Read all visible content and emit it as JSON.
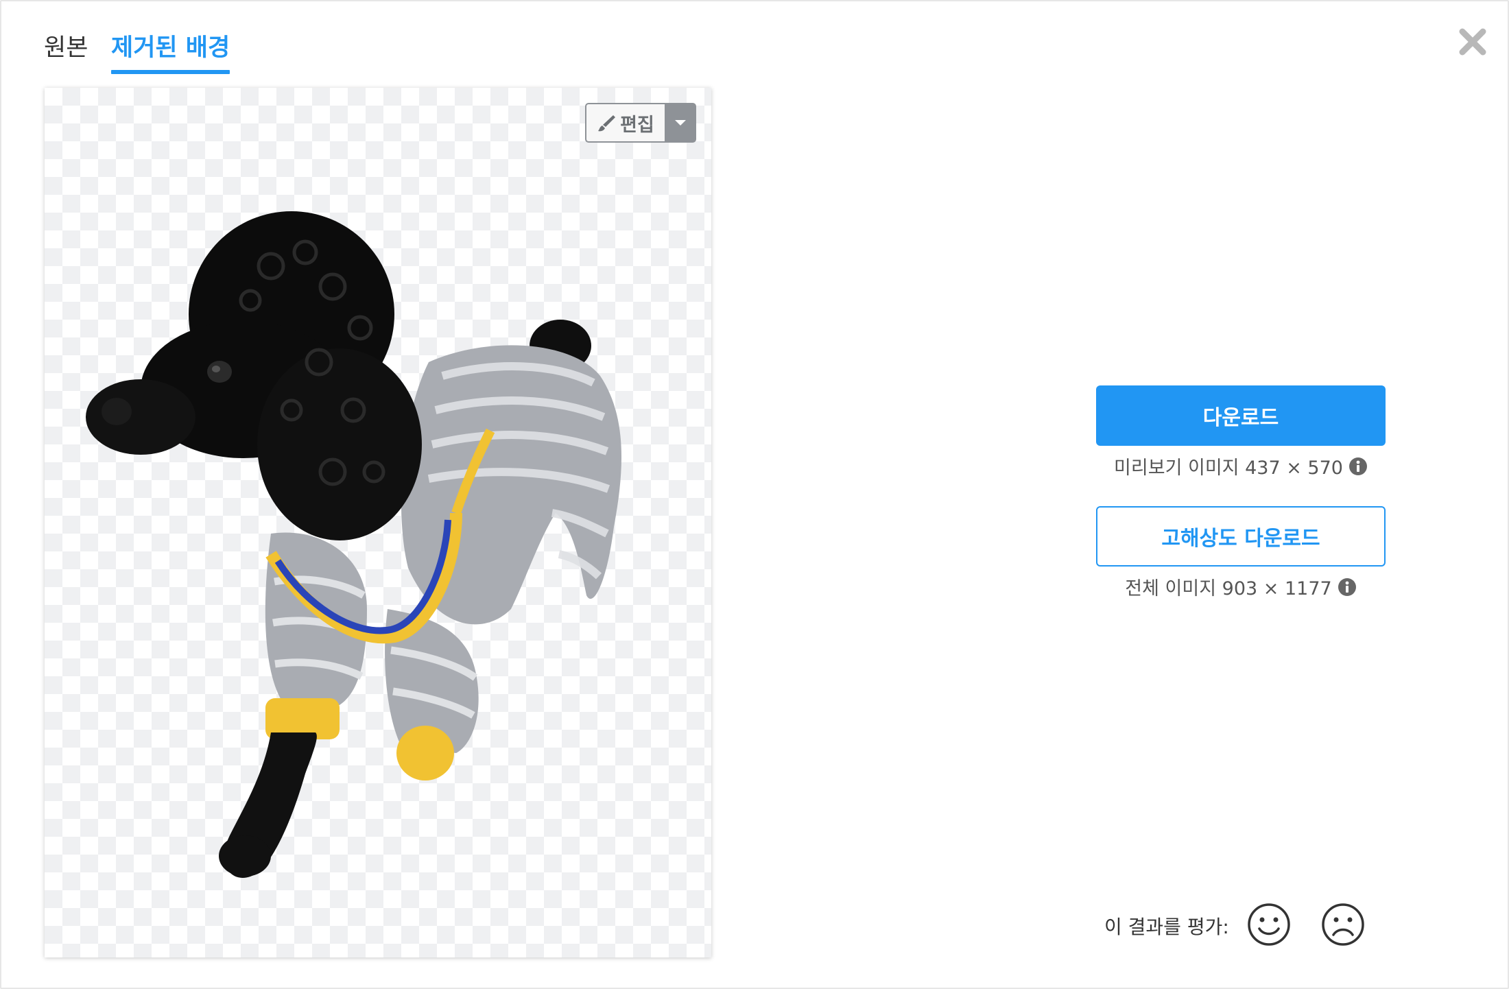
{
  "tabs": {
    "original_label": "원본",
    "removed_label": "제거된 배경"
  },
  "editor": {
    "edit_label": "편집"
  },
  "downloads": {
    "primary_label": "다운로드",
    "preview_info": "미리보기 이미지 437 × 570",
    "hd_label": "고해상도 다운로드",
    "full_info": "전체 이미지 903 × 1177"
  },
  "rating": {
    "label": "이 결과를 평가:"
  },
  "icons": {
    "close": "close-icon",
    "brush": "brush-icon",
    "caret": "chevron-down-icon",
    "info": "info-icon",
    "happy": "smiley-icon",
    "sad": "frown-icon"
  },
  "colors": {
    "accent": "#2196f3",
    "checker": "#eff0f2",
    "edit_gray": "#8e9297"
  }
}
